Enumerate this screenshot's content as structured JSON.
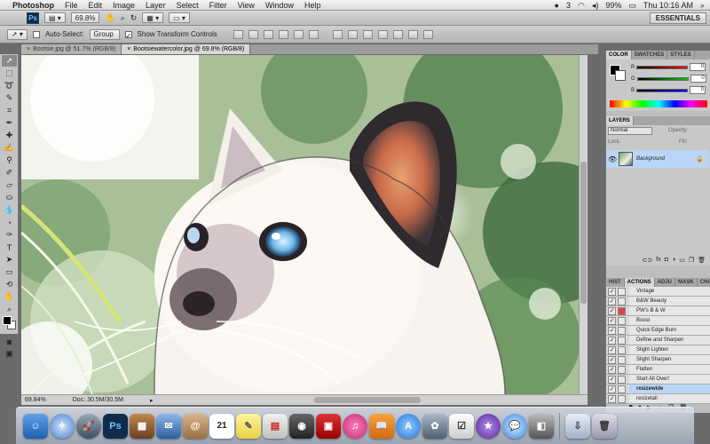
{
  "menubar": {
    "app_name": "Photoshop",
    "menus": [
      "File",
      "Edit",
      "Image",
      "Layer",
      "Select",
      "Filter",
      "View",
      "Window",
      "Help"
    ],
    "battery": "99%",
    "clock": "Thu 10:16 AM",
    "badge_count": "3"
  },
  "appbar": {
    "ps_label": "Ps",
    "zoom": "69.8%",
    "workspace": "ESSENTIALS"
  },
  "options": {
    "auto_select_label": "Auto-Select:",
    "auto_select_value": "Group",
    "transform_label": "Show Transform Controls"
  },
  "documents": {
    "tabs": [
      {
        "label": "Bootsie.jpg @ 51.7% (RGB/8)",
        "close": "×"
      },
      {
        "label": "Bootsiewatercolor.jpg @ 69.8% (RGB/8)",
        "close": "×"
      }
    ]
  },
  "status": {
    "zoom": "69.84%",
    "doc": "Doc: 30.5M/30.5M"
  },
  "color_panel": {
    "tabs": [
      "COLOR",
      "SWATCHES",
      "STYLES"
    ],
    "channels": [
      {
        "name": "R",
        "value": "0"
      },
      {
        "name": "G",
        "value": "0"
      },
      {
        "name": "B",
        "value": "0"
      }
    ]
  },
  "layers_panel": {
    "tab": "LAYERS",
    "blend_mode": "Normal",
    "opacity_label": "Opacity:",
    "lock_label": "Lock:",
    "fill_label": "Fill:",
    "layer_name": "Background"
  },
  "actions_panel": {
    "tabs": [
      "HIST",
      "ACTIONS",
      "ADJU",
      "MASK",
      "CHAN"
    ],
    "items": [
      "Vintage",
      "B&W Beauty",
      "PW's B & W",
      "Boost",
      "Quick Edge Burn",
      "Define and Sharpen",
      "Slight Lighten",
      "Slight Sharpen",
      "Flatten",
      "Start All Over!",
      "resizewide",
      "resizetall"
    ],
    "highlighted": "resizewide"
  },
  "dock": {
    "ps_label": "Ps",
    "calendar_day": "21"
  }
}
